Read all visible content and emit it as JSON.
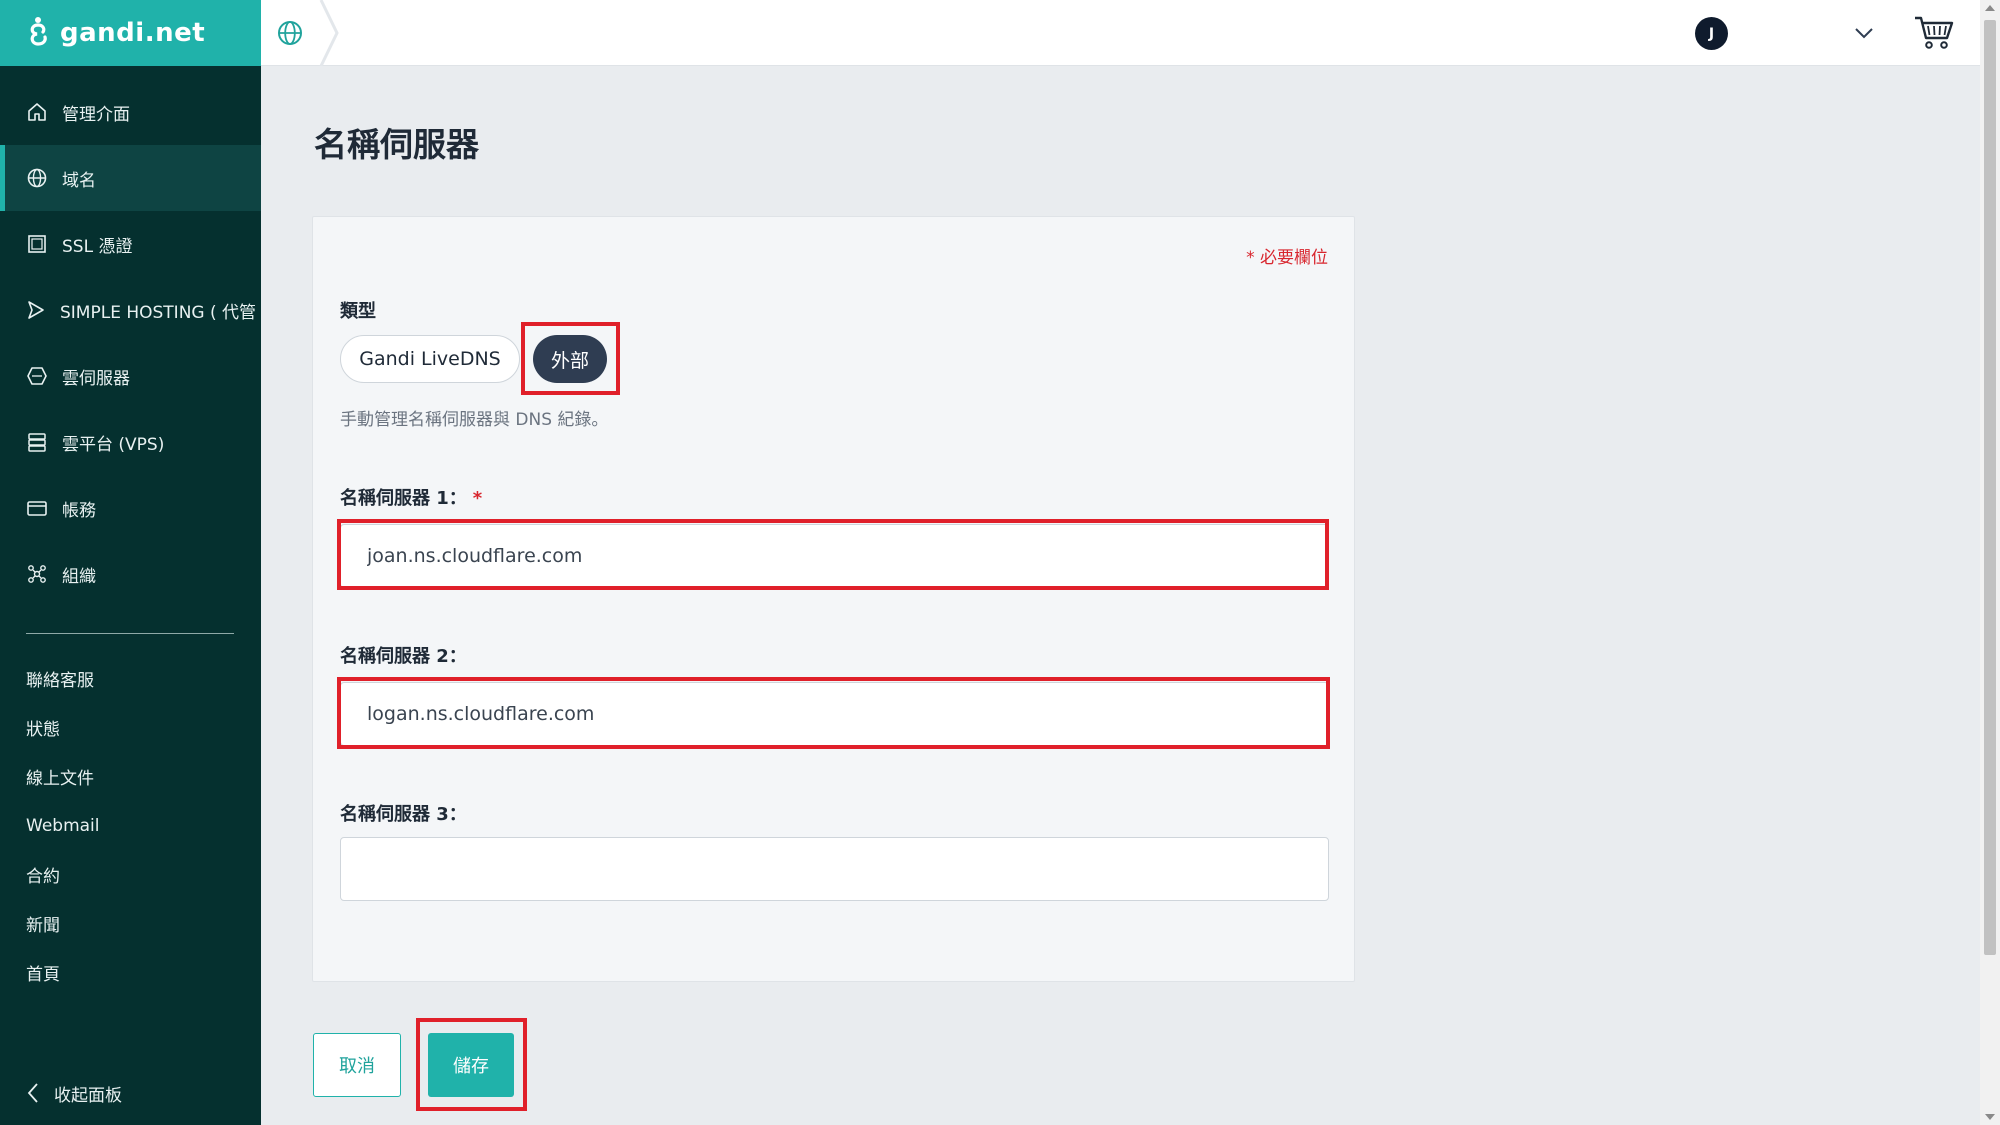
{
  "brand": {
    "name": "gandi.net"
  },
  "sidebar": {
    "items": [
      {
        "label": "管理介面",
        "icon": "home-icon"
      },
      {
        "label": "域名",
        "icon": "globe-icon",
        "active": true
      },
      {
        "label": "SSL 憑證",
        "icon": "certificate-icon"
      },
      {
        "label": "SIMPLE HOSTING ( 代管",
        "icon": "play-icon"
      },
      {
        "label": "雲伺服器",
        "icon": "cloud-server-icon"
      },
      {
        "label": "雲平台 (VPS)",
        "icon": "vps-icon"
      },
      {
        "label": "帳務",
        "icon": "credit-card-icon"
      },
      {
        "label": "組織",
        "icon": "organization-icon"
      }
    ],
    "links": [
      "聯絡客服",
      "狀態",
      "線上文件",
      "Webmail",
      "合約",
      "新聞",
      "首頁"
    ],
    "collapse_label": "收起面板"
  },
  "header": {
    "avatar_initial": "J"
  },
  "page": {
    "title": "名稱伺服器",
    "required_note": "* 必要欄位",
    "type_label": "類型",
    "type_options": [
      "Gandi LiveDNS",
      "外部"
    ],
    "type_selected": "外部",
    "type_help": "手動管理名稱伺服器與 DNS 紀錄。",
    "fields": [
      {
        "label": "名稱伺服器 1：",
        "required": "*",
        "value": "joan.ns.cloudflare.com"
      },
      {
        "label": "名稱伺服器 2：",
        "value": "logan.ns.cloudflare.com"
      },
      {
        "label": "名稱伺服器 3：",
        "value": ""
      }
    ],
    "cancel_label": "取消",
    "save_label": "儲存"
  },
  "colors": {
    "sidebar_bg": "#05302f",
    "brand_teal": "#20b2aa",
    "highlight_red": "#e0202a",
    "selected_pill": "#2f3d52"
  }
}
